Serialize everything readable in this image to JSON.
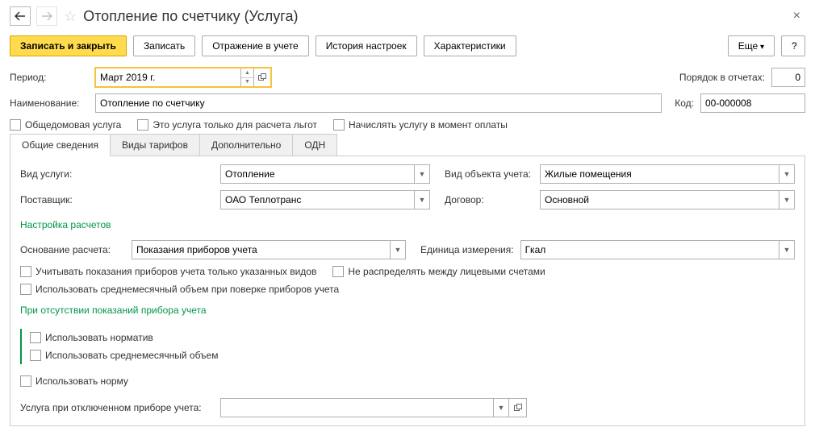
{
  "nav": {
    "back": "←",
    "forward": "→"
  },
  "titlebar": {
    "title": "Отопление по счетчику (Услуга)"
  },
  "toolbar": {
    "save_close": "Записать и закрыть",
    "save": "Записать",
    "reflect": "Отражение в учете",
    "history": "История настроек",
    "characteristics": "Характеристики",
    "more": "Еще",
    "help": "?"
  },
  "fields": {
    "period_label": "Период:",
    "period_value": "Март 2019 г.",
    "order_label": "Порядок в отчетах:",
    "order_value": "0",
    "name_label": "Наименование:",
    "name_value": "Отопление по счетчику",
    "code_label": "Код:",
    "code_value": "00-000008",
    "cb_common": "Общедомовая услуга",
    "cb_benefits": "Это услуга только для расчета льгот",
    "cb_on_payment": "Начислять услугу в момент оплаты"
  },
  "tabs": {
    "general": "Общие сведения",
    "tariffs": "Виды тарифов",
    "additional": "Дополнительно",
    "odn": "ОДН"
  },
  "general": {
    "service_type_label": "Вид услуги:",
    "service_type_value": "Отопление",
    "object_type_label": "Вид объекта учета:",
    "object_type_value": "Жилые помещения",
    "supplier_label": "Поставщик:",
    "supplier_value": "ОАО Теплотранс",
    "contract_label": "Договор:",
    "contract_value": "Основной",
    "calc_settings_title": "Настройка расчетов",
    "calc_basis_label": "Основание расчета:",
    "calc_basis_value": "Показания приборов учета",
    "unit_label": "Единица измерения:",
    "unit_value": "Гкал",
    "cb_specified_types": "Учитывать показания приборов учета только указанных видов",
    "cb_no_distribute": "Не распределять между лицевыми счетами",
    "cb_avg_volume_check": "Использовать среднемесячный объем при поверке приборов учета",
    "no_readings_title": "При отсутствии показаний прибора учета",
    "cb_use_norm": "Использовать норматив",
    "cb_use_avg": "Использовать среднемесячный объем",
    "cb_use_norma": "Использовать норму",
    "disabled_service_label": "Услуга при отключенном приборе учета:",
    "disabled_service_value": ""
  }
}
